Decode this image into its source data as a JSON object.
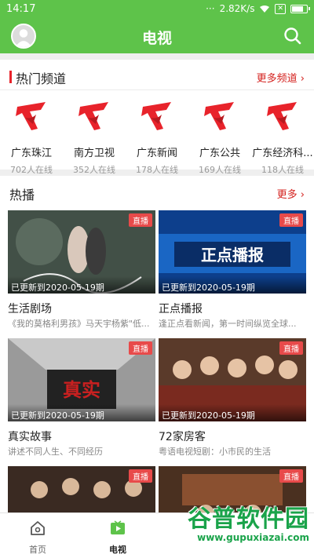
{
  "status_bar": {
    "time": "14:17",
    "net_speed": "2.82K/s",
    "battery_level": 0.85
  },
  "header": {
    "title": "电视",
    "avatar_icon": "user-avatar-icon",
    "search_icon": "search-icon"
  },
  "channels_section": {
    "title": "热门频道",
    "more_label": "更多频道 ›",
    "items": [
      {
        "name": "广东珠江",
        "online": "702人在线"
      },
      {
        "name": "南方卫视",
        "online": "352人在线"
      },
      {
        "name": "广东新闻",
        "online": "178人在线"
      },
      {
        "name": "广东公共",
        "online": "169人在线"
      },
      {
        "name": "广东经济科...",
        "online": "118人在线"
      }
    ]
  },
  "hot_section": {
    "title": "热播",
    "more_label": "更多 ›",
    "cards": [
      {
        "live": "直播",
        "updated": "已更新到2020-05-19期",
        "title": "生活剧场",
        "desc": "《我的莫格利男孩》马天宇杨紫\"低..."
      },
      {
        "live": "直播",
        "updated": "已更新到2020-05-19期",
        "title": "正点播报",
        "desc": "逢正点看新闻，第一时间纵览全球..."
      },
      {
        "live": "直播",
        "updated": "已更新到2020-05-19期",
        "title": "真实故事",
        "desc": "讲述不同人生、不同经历"
      },
      {
        "live": "直播",
        "updated": "已更新到2020-05-19期",
        "title": "72家房客",
        "desc": "粤语电视短剧：小市民的生活"
      },
      {
        "live": "直播"
      },
      {
        "live": "直播"
      }
    ]
  },
  "tabbar": {
    "tabs": [
      {
        "label": "首页"
      },
      {
        "label": "电视"
      }
    ]
  },
  "colors": {
    "brand_green": "#5ec34a",
    "accent_red": "#d4211e",
    "live_red": "#e84a4a"
  },
  "watermark": {
    "text": "谷普软件园",
    "url": "www.gupuxiazai.com"
  }
}
